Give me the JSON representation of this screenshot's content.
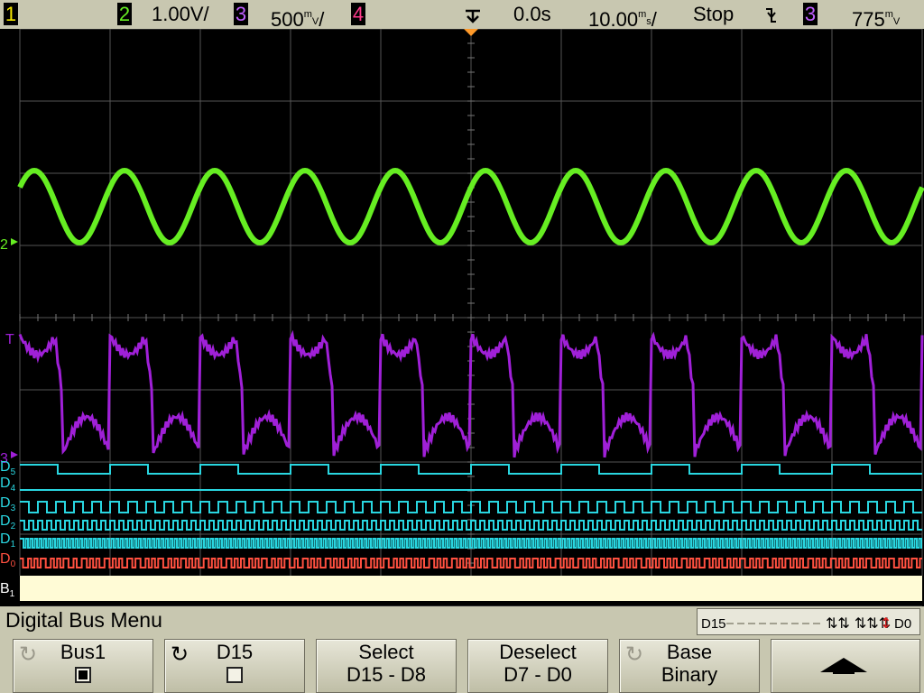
{
  "status_bar": {
    "ch1": {
      "number": "1",
      "color": "#f5e600"
    },
    "ch2": {
      "number": "2",
      "scale": "1.00V/",
      "color": "#66ee22"
    },
    "ch3": {
      "number": "3",
      "scale": "500mV/",
      "color": "#c060ff"
    },
    "ch4": {
      "number": "4",
      "color": "#ff3a8a"
    },
    "trigger_mode_icon": "trigger-position-icon",
    "time_delay": "0.0s",
    "time_scale": "10.00ms/",
    "run_state": "Stop",
    "trigger_slope_icon": "falling-edge-icon",
    "trigger_source": "3",
    "trigger_level": "775mV"
  },
  "screen": {
    "grid": true,
    "channel2_marker": "2",
    "channel3_marker": "3",
    "trigger_marker": "T",
    "digital_labels": [
      "D",
      "D",
      "D",
      "D",
      "D",
      "D",
      "B"
    ],
    "digital_subscripts": [
      "5",
      "4",
      "3",
      "2",
      "1",
      "0",
      "1"
    ],
    "bus_label": "B",
    "bus_subscript": "1",
    "colors": {
      "ch2": "#66ee22",
      "ch3": "#a020d8",
      "digital": "#29d6e0",
      "d0": "#ff5040",
      "bus": "#fffbd6"
    }
  },
  "menu": {
    "title": "Digital Bus Menu",
    "bit_indicator": {
      "left": "D15",
      "right": "D0"
    },
    "softkeys": [
      {
        "line1": "Bus1",
        "checked": true,
        "icon": "knob-icon"
      },
      {
        "line1": "D15",
        "checked": false,
        "icon": "knob-icon"
      },
      {
        "line1": "Select",
        "line2": "D15 - D8"
      },
      {
        "line1": "Deselect",
        "line2": "D7 - D0"
      },
      {
        "line1": "Base",
        "line2": "Binary",
        "icon": "knob-icon"
      },
      {
        "icon": "up-arrow-icon"
      }
    ]
  }
}
